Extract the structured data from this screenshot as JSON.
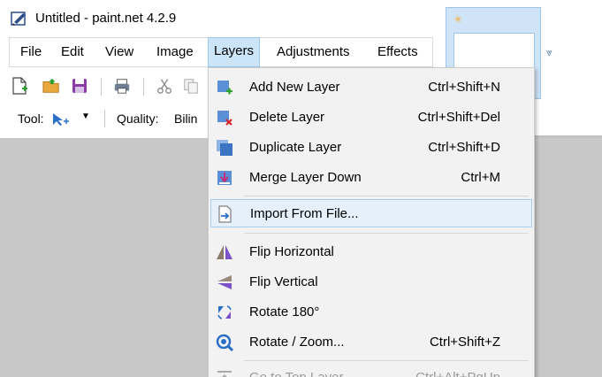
{
  "window": {
    "title": "Untitled - paint.net 4.2.9"
  },
  "menubar": {
    "items": [
      {
        "label": "File"
      },
      {
        "label": "Edit"
      },
      {
        "label": "View"
      },
      {
        "label": "Image"
      },
      {
        "label": "Layers",
        "open": true
      },
      {
        "label": "Adjustments"
      },
      {
        "label": "Effects"
      }
    ]
  },
  "toolbar": {
    "icons": [
      "new-file-icon",
      "open-folder-icon",
      "save-icon",
      "print-icon",
      "cut-icon",
      "copy-icon"
    ]
  },
  "toolrow": {
    "tool_label": "Tool:",
    "tool_icon": "pointer-move-icon",
    "quality_label": "Quality:",
    "quality_value": "Bilin"
  },
  "layers_menu": {
    "items": [
      {
        "label": "Add New Layer",
        "shortcut": "Ctrl+Shift+N",
        "icon": "add-layer-icon"
      },
      {
        "label": "Delete Layer",
        "shortcut": "Ctrl+Shift+Del",
        "icon": "delete-layer-icon"
      },
      {
        "label": "Duplicate Layer",
        "shortcut": "Ctrl+Shift+D",
        "icon": "duplicate-layer-icon"
      },
      {
        "label": "Merge Layer Down",
        "shortcut": "Ctrl+M",
        "icon": "merge-down-icon"
      },
      {
        "label": "Import From File...",
        "shortcut": "",
        "icon": "import-file-icon",
        "highlighted": true
      },
      {
        "label": "Flip Horizontal",
        "shortcut": "",
        "icon": "flip-horizontal-icon"
      },
      {
        "label": "Flip Vertical",
        "shortcut": "",
        "icon": "flip-vertical-icon"
      },
      {
        "label": "Rotate 180°",
        "shortcut": "",
        "icon": "rotate-180-icon"
      },
      {
        "label": "Rotate / Zoom...",
        "shortcut": "Ctrl+Shift+Z",
        "icon": "rotate-zoom-icon"
      },
      {
        "label": "Go to Top Layer",
        "shortcut": "Ctrl+Alt+PgUp",
        "icon": "top-layer-icon",
        "disabled": true
      }
    ]
  },
  "colors": {
    "accent": "#1e72c9",
    "menu_highlight": "#e5f0fb",
    "workspace": "#c8c8c8"
  }
}
